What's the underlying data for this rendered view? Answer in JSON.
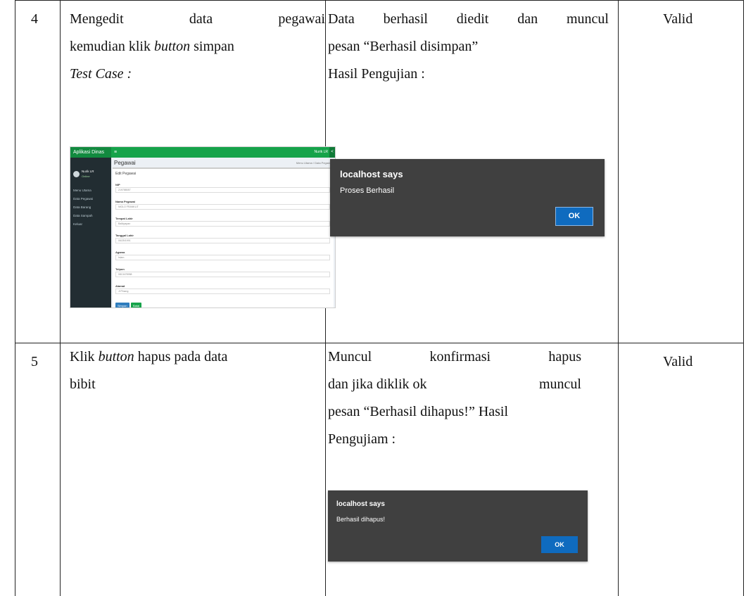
{
  "rows": [
    {
      "no": "4",
      "step_line1": [
        "Mengedit",
        "data",
        "pegawai"
      ],
      "step_line2_pre": "kemudian klik ",
      "step_line2_em": "button",
      "step_line2_post": " simpan",
      "test_case": "Test Case :",
      "result_line1": [
        "Data",
        "berhasil",
        "diedit",
        "dan",
        "muncul"
      ],
      "result_line2": "pesan “Berhasil disimpan”",
      "result_line3": "Hasil Pengujian :",
      "status": "Valid"
    },
    {
      "no": "5",
      "step_line1_pre": "Klik ",
      "step_line1_em": "button",
      "step_line1_post": " hapus pada data",
      "step_line2": "bibit",
      "result_line1": [
        "Muncul",
        "konfirmasi",
        "hapus"
      ],
      "result_line2": [
        "dan jika diklik ok",
        "muncul"
      ],
      "result_line3": "pesan “Berhasil dihapus!” Hasil",
      "result_line4": "Pengujiam :",
      "status": "Valid"
    }
  ],
  "app_screenshot": {
    "brand": "Aplikasi Dinas",
    "user": "Nurik LR",
    "online": "Online",
    "menu": [
      "Menu Utama",
      "Data Pegawai",
      "Data Barang",
      "Data Sampah",
      "Keluar"
    ],
    "page_title": "Pegawai",
    "breadcrumb": "Menu Utama  /  Data Pegawai",
    "box_title": "Edit Pegawai",
    "fields": [
      {
        "label": "NIP",
        "value": "219788087"
      },
      {
        "label": "Nama Pegawai",
        "value": "NIGLO FRANKLIT"
      },
      {
        "label": "Tempat Lahir",
        "value": "Balikpapan"
      },
      {
        "label": "Tanggal Lahir",
        "value": "06/25/1991"
      },
      {
        "label": "Agama",
        "value": "Islam"
      },
      {
        "label": "Telpon",
        "value": "0813478958"
      },
      {
        "label": "Alamat",
        "value": "Jl Pinang"
      }
    ],
    "save_label": "Simpan",
    "back_label": "Batal"
  },
  "dialog_edit": {
    "header": "localhost says",
    "message": "Proses Berhasil",
    "ok": "OK"
  },
  "dialog_delete": {
    "header": "localhost says",
    "message": "Berhasil dihapus!",
    "ok": "OK"
  }
}
